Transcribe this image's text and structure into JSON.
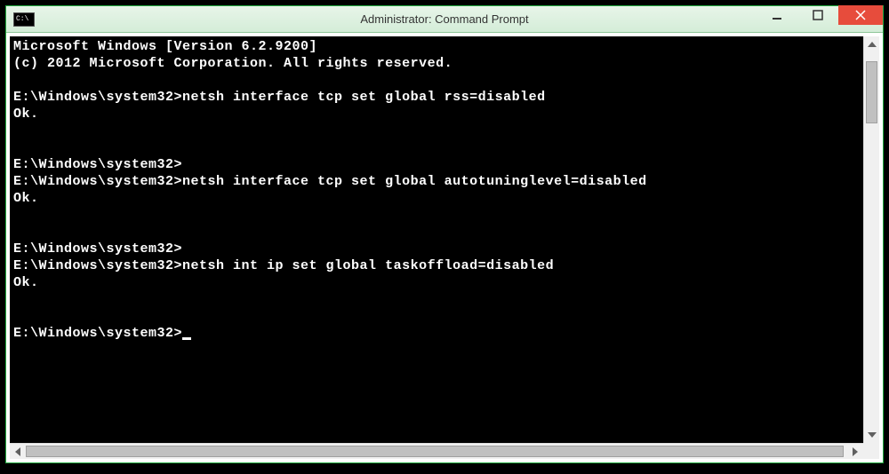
{
  "window": {
    "title": "Administrator: Command Prompt",
    "icon_label": "C:\\"
  },
  "console": {
    "lines": [
      "Microsoft Windows [Version 6.2.9200]",
      "(c) 2012 Microsoft Corporation. All rights reserved.",
      "",
      "E:\\Windows\\system32>netsh interface tcp set global rss=disabled",
      "Ok.",
      "",
      "",
      "E:\\Windows\\system32>",
      "E:\\Windows\\system32>netsh interface tcp set global autotuninglevel=disabled",
      "Ok.",
      "",
      "",
      "E:\\Windows\\system32>",
      "E:\\Windows\\system32>netsh int ip set global taskoffload=disabled",
      "Ok.",
      "",
      "",
      "E:\\Windows\\system32>"
    ],
    "cursor_line_index": 17
  }
}
